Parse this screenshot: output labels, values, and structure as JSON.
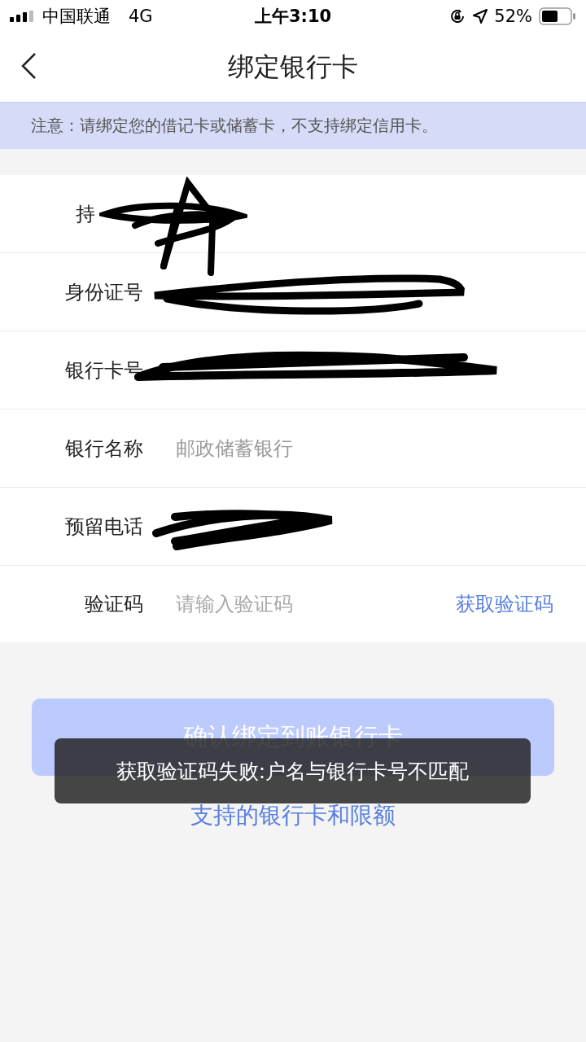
{
  "status_bar": {
    "carrier": "中国联通",
    "network": "4G",
    "time": "上午3:10",
    "battery": "52%"
  },
  "nav": {
    "title": "绑定银行卡"
  },
  "notice": "注意：请绑定您的借记卡或储蓄卡，不支持绑定信用卡。",
  "form": [
    {
      "kind": "partial",
      "label": "持"
    },
    {
      "kind": "redacted",
      "label": "身份证号"
    },
    {
      "kind": "redacted",
      "label": "银行卡号"
    },
    {
      "kind": "value",
      "label": "银行名称",
      "value": "邮政储蓄银行"
    },
    {
      "kind": "redacted",
      "label": "预留电话"
    },
    {
      "kind": "code",
      "label": "验证码",
      "placeholder": "请输入验证码",
      "action": "获取验证码"
    }
  ],
  "confirm_button": {
    "label": "确认绑定到账银行卡",
    "disabled": true
  },
  "limits_link": "支持的银行卡和限额",
  "toast": "获取验证码失败:户名与银行卡号不匹配"
}
